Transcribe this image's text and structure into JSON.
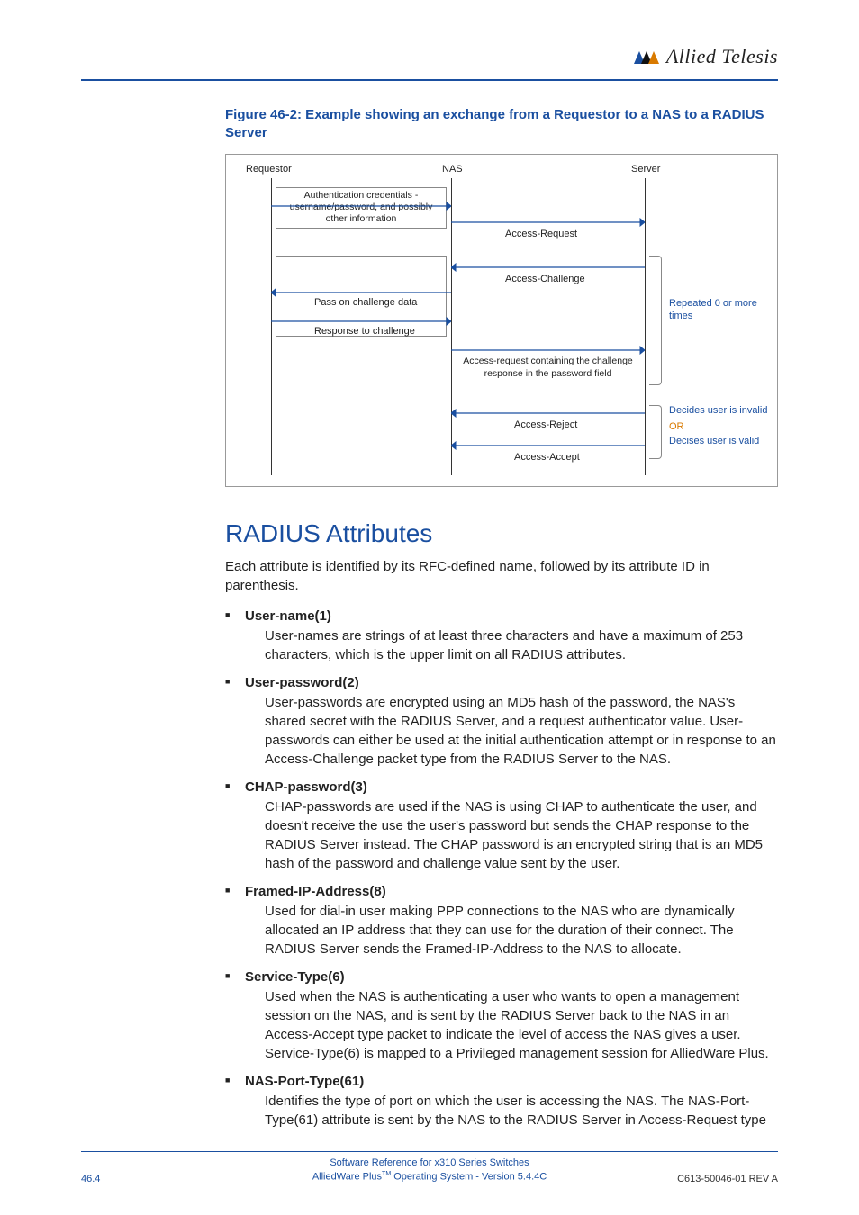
{
  "header": {
    "brand": "Allied Telesis"
  },
  "figure": {
    "caption": "Figure 46-2: Example showing an exchange from a Requestor to a NAS to a RADIUS Server",
    "labels": {
      "requestor": "Requestor",
      "nas": "NAS",
      "server": "Server",
      "creds": "Authentication credentials - username/password, and possibly other information",
      "access_request": "Access-Request",
      "access_challenge": "Access-Challenge",
      "pass_on": "Pass on challenge data",
      "response": "Response to challenge",
      "repeated": "Repeated 0 or more times",
      "containing": "Access-request containing the challenge response in the password field",
      "reject": "Access-Reject",
      "accept": "Access-Accept",
      "invalid": "Decides user is invalid",
      "or": "OR",
      "valid": "Decises user is valid"
    }
  },
  "section": {
    "title": "RADIUS Attributes",
    "intro": "Each attribute is identified by its RFC-defined name, followed by its attribute ID in parenthesis."
  },
  "attributes": [
    {
      "title": "User-name(1)",
      "body": "User-names are strings of at least three characters and have a maximum of 253 characters, which is the upper limit on all RADIUS attributes."
    },
    {
      "title": "User-password(2)",
      "body": "User-passwords are encrypted using an MD5 hash of the password, the NAS's shared secret with the RADIUS Server, and a request authenticator value. User-passwords can either be used at the initial authentication attempt or in response to an Access-Challenge packet type from the RADIUS Server to the NAS."
    },
    {
      "title": "CHAP-password(3)",
      "body": "CHAP-passwords are used if the NAS is using CHAP to authenticate the user, and doesn't receive the use the user's password but sends the CHAP response to the RADIUS Server instead. The CHAP password is an encrypted string that is an MD5 hash of the password and challenge value sent by the user."
    },
    {
      "title": "Framed-IP-Address(8)",
      "body": "Used for dial-in user making PPP connections to the NAS who are dynamically allocated an IP address that they can use for the duration of their connect. The RADIUS Server sends the Framed-IP-Address to the NAS to allocate."
    },
    {
      "title": "Service-Type(6)",
      "body": "Used when the NAS is authenticating a user who wants to open a management session on the NAS, and is sent by the RADIUS Server back to the NAS in an Access-Accept type packet to indicate the level of access the NAS gives a user. Service-Type(6) is mapped to a Privileged management session for AlliedWare Plus."
    },
    {
      "title": "NAS-Port-Type(61)",
      "body": "Identifies the type of port on which the user is accessing the NAS. The NAS-Port-Type(61) attribute is sent by the NAS to the RADIUS Server in Access-Request type"
    }
  ],
  "footer": {
    "page": "46.4",
    "line1": "Software Reference for x310 Series Switches",
    "line2a": "AlliedWare Plus",
    "line2b": " Operating System  - Version 5.4.4C",
    "tm": "TM",
    "rev": "C613-50046-01 REV A"
  }
}
